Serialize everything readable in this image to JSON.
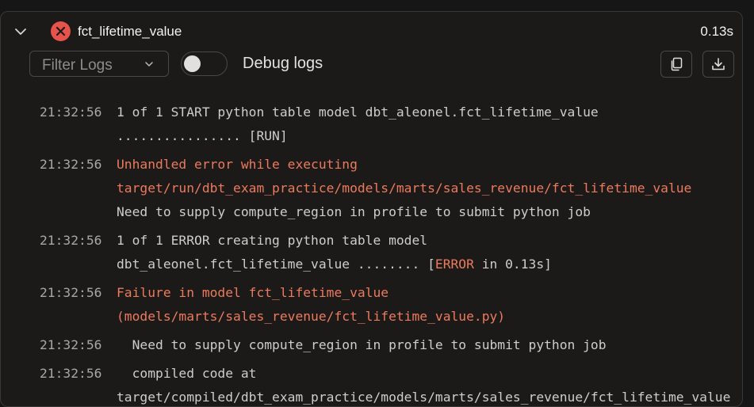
{
  "header": {
    "model_name": "fct_lifetime_value",
    "duration": "0.13s",
    "status": "error",
    "status_color": "#e5534b"
  },
  "toolbar": {
    "filter_placeholder": "Filter Logs",
    "toggle_label": "Debug logs",
    "toggle_on": false
  },
  "logs": [
    {
      "time": "21:32:56",
      "lines": [
        {
          "text": "1 of 1 START python table model dbt_aleonel.fct_lifetime_value",
          "error": false
        },
        {
          "text": "................ [RUN]",
          "error": false
        }
      ]
    },
    {
      "time": "21:32:56",
      "lines": [
        {
          "text": "Unhandled error while executing",
          "error": true
        },
        {
          "text": "target/run/dbt_exam_practice/models/marts/sales_revenue/fct_lifetime_value",
          "error": true
        },
        {
          "text": "Need to supply compute_region in profile to submit python job",
          "error": false
        }
      ]
    },
    {
      "time": "21:32:56",
      "lines": [
        {
          "text": "1 of 1 ERROR creating python table model",
          "error": false
        },
        {
          "pre": "dbt_aleonel.fct_lifetime_value ........ [",
          "highlight": "ERROR",
          "post": " in 0.13s]"
        }
      ]
    },
    {
      "time": "21:32:56",
      "lines": [
        {
          "text": "Failure in model fct_lifetime_value",
          "error": true
        },
        {
          "text": "(models/marts/sales_revenue/fct_lifetime_value.py)",
          "error": true
        }
      ]
    },
    {
      "time": "21:32:56",
      "lines": [
        {
          "text": "  Need to supply compute_region in profile to submit python job",
          "error": false
        }
      ]
    },
    {
      "time": "21:32:56",
      "lines": [
        {
          "text": "  compiled code at",
          "error": false
        },
        {
          "text": "target/compiled/dbt_exam_practice/models/marts/sales_revenue/fct_lifetime_value",
          "error": false
        }
      ]
    }
  ]
}
